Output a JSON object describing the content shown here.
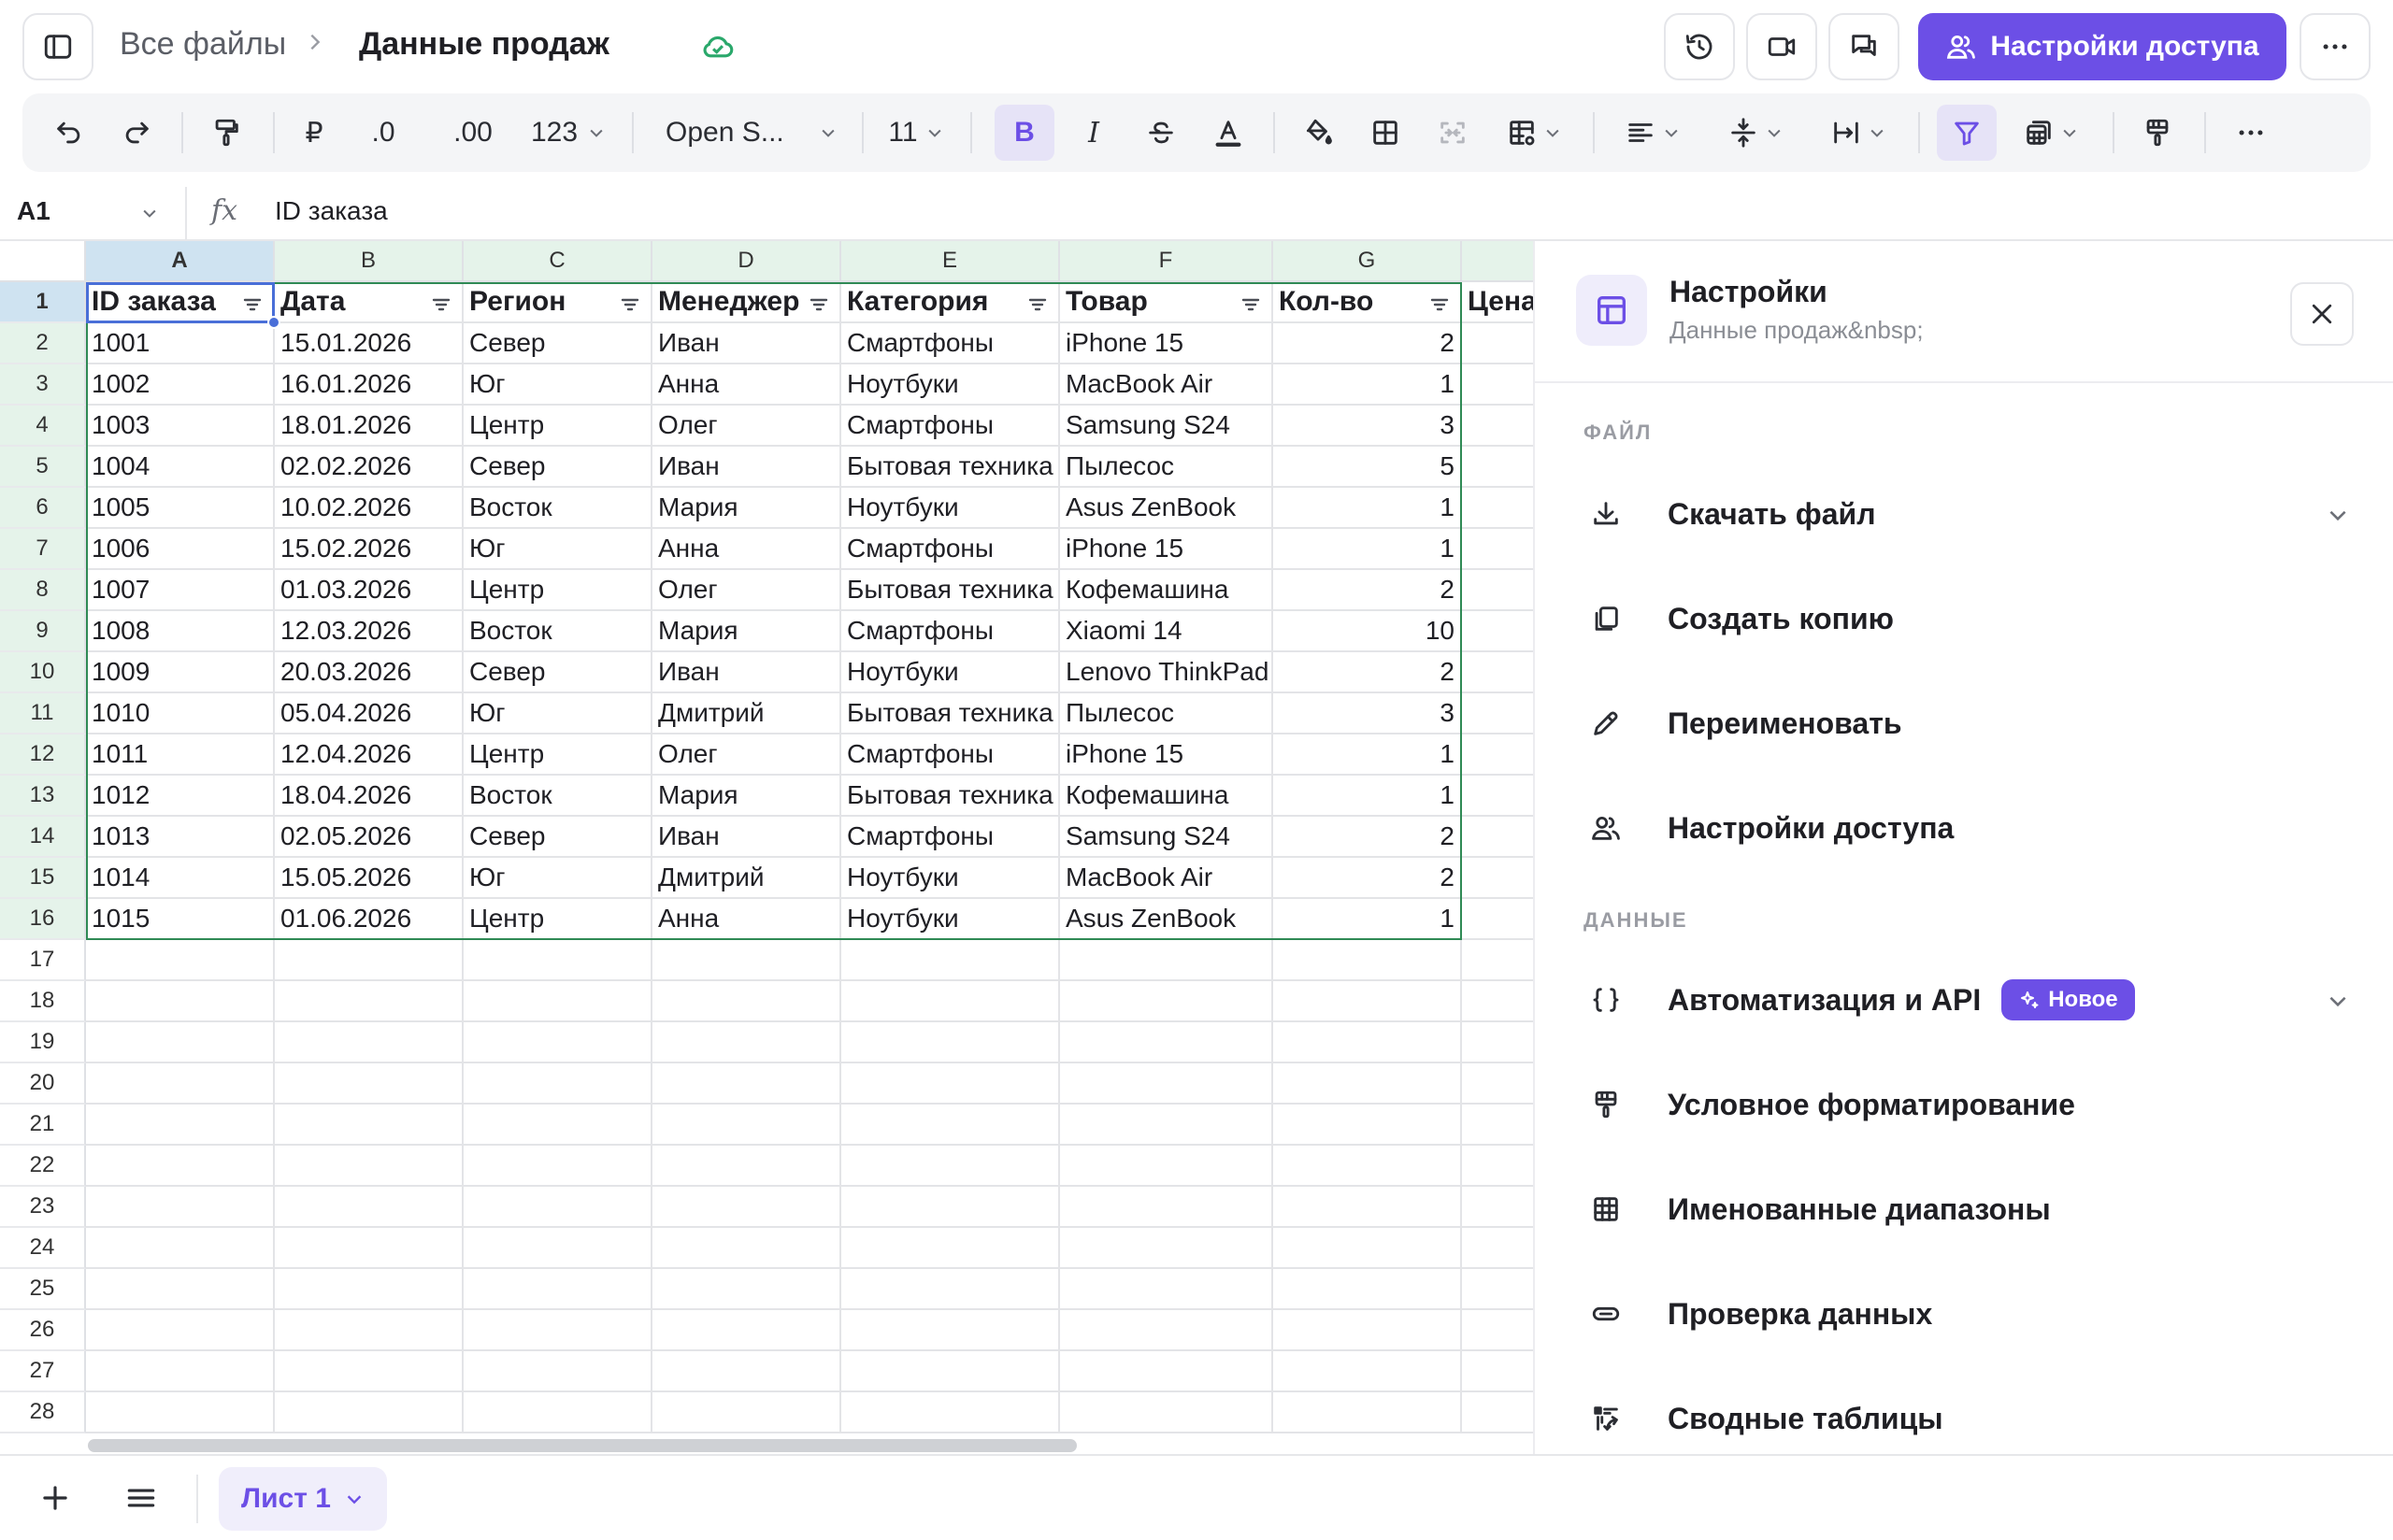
{
  "breadcrumb": {
    "root": "Все файлы",
    "current": "Данные продаж"
  },
  "share_button": "Настройки доступа",
  "toolbar": {
    "currency": "₽",
    "decrease_decimals": ".0",
    "increase_decimals": ".00",
    "number_format": "123",
    "font": "Open S...",
    "font_size": "11",
    "bold": "B",
    "italic": "I"
  },
  "formula_bar": {
    "cell_ref": "A1",
    "fx": "fx",
    "value": "ID заказа"
  },
  "sheet": {
    "columns": [
      "A",
      "B",
      "C",
      "D",
      "E",
      "F",
      "G"
    ],
    "row_numbers": [
      "1",
      "2",
      "3",
      "4",
      "5",
      "6",
      "7",
      "8",
      "9",
      "10",
      "11",
      "12",
      "13",
      "14",
      "15",
      "16",
      "17",
      "18",
      "19",
      "20",
      "21",
      "22",
      "23",
      "24",
      "25",
      "26",
      "27",
      "28"
    ],
    "headers": [
      "ID заказа",
      "Дата",
      "Регион",
      "Менеджер",
      "Категория",
      "Товар",
      "Кол-во",
      "Цена"
    ],
    "rows": [
      [
        "1001",
        "15.01.2026",
        "Север",
        "Иван",
        "Смартфоны",
        "iPhone 15",
        "2"
      ],
      [
        "1002",
        "16.01.2026",
        "Юг",
        "Анна",
        "Ноутбуки",
        "MacBook Air",
        "1"
      ],
      [
        "1003",
        "18.01.2026",
        "Центр",
        "Олег",
        "Смартфоны",
        "Samsung S24",
        "3"
      ],
      [
        "1004",
        "02.02.2026",
        "Север",
        "Иван",
        "Бытовая техника",
        "Пылесос",
        "5"
      ],
      [
        "1005",
        "10.02.2026",
        "Восток",
        "Мария",
        "Ноутбуки",
        "Asus ZenBook",
        "1"
      ],
      [
        "1006",
        "15.02.2026",
        "Юг",
        "Анна",
        "Смартфоны",
        "iPhone 15",
        "1"
      ],
      [
        "1007",
        "01.03.2026",
        "Центр",
        "Олег",
        "Бытовая техника",
        "Кофемашина",
        "2"
      ],
      [
        "1008",
        "12.03.2026",
        "Восток",
        "Мария",
        "Смартфоны",
        "Xiaomi 14",
        "10"
      ],
      [
        "1009",
        "20.03.2026",
        "Север",
        "Иван",
        "Ноутбуки",
        "Lenovo ThinkPad",
        "2"
      ],
      [
        "1010",
        "05.04.2026",
        "Юг",
        "Дмитрий",
        "Бытовая техника",
        "Пылесос",
        "3"
      ],
      [
        "1011",
        "12.04.2026",
        "Центр",
        "Олег",
        "Смартфоны",
        "iPhone 15",
        "1"
      ],
      [
        "1012",
        "18.04.2026",
        "Восток",
        "Мария",
        "Бытовая техника",
        "Кофемашина",
        "1"
      ],
      [
        "1013",
        "02.05.2026",
        "Север",
        "Иван",
        "Смартфоны",
        "Samsung S24",
        "2"
      ],
      [
        "1014",
        "15.05.2026",
        "Юг",
        "Дмитрий",
        "Ноутбуки",
        "MacBook Air",
        "2"
      ],
      [
        "1015",
        "01.06.2026",
        "Центр",
        "Анна",
        "Ноутбуки",
        "Asus ZenBook",
        "1"
      ]
    ]
  },
  "panel": {
    "title": "Настройки",
    "subtitle": "Данные продаж&nbsp;",
    "section_file": "ФАЙЛ",
    "section_data": "ДАННЫЕ",
    "items_file": [
      {
        "label": "Скачать файл",
        "icon": "download-icon"
      },
      {
        "label": "Создать копию",
        "icon": "copy-icon"
      },
      {
        "label": "Переименовать",
        "icon": "pencil-icon"
      },
      {
        "label": "Настройки доступа",
        "icon": "users-icon"
      }
    ],
    "items_data": [
      {
        "label": "Автоматизация и API",
        "icon": "braces-icon",
        "badge": "Новое"
      },
      {
        "label": "Условное форматирование",
        "icon": "paint-roller-icon"
      },
      {
        "label": "Именованные диапазоны",
        "icon": "grid-icon"
      },
      {
        "label": "Проверка данных",
        "icon": "toggle-icon"
      },
      {
        "label": "Сводные таблицы",
        "icon": "pivot-table-icon"
      }
    ]
  },
  "bottom": {
    "sheet_tab": "Лист 1"
  },
  "colors": {
    "accent": "#6c4fe6",
    "selection": "#4a6fd8",
    "header_highlight": "#e5f3ea",
    "saved": "#2aa86b"
  }
}
